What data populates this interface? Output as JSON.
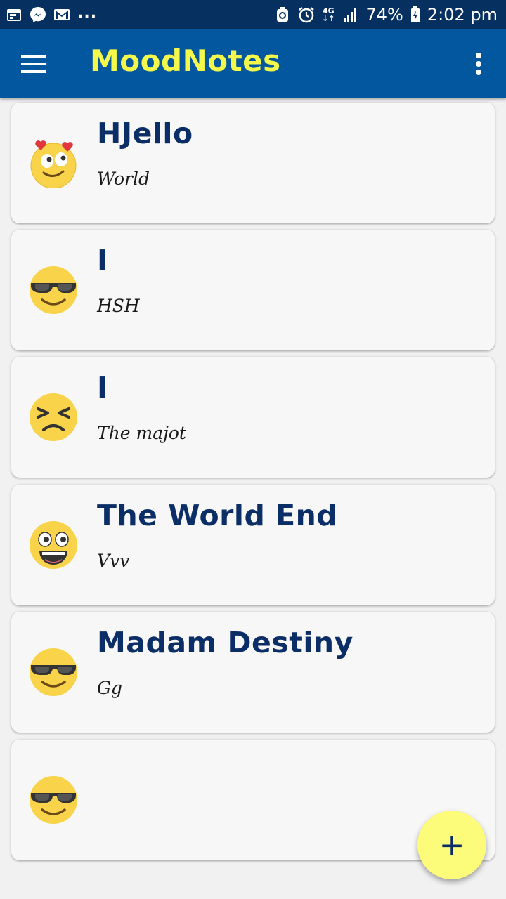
{
  "status_bar": {
    "dots": "...",
    "network_type": "4G",
    "battery_percent": "74%",
    "time": "2:02 pm",
    "icons": [
      "calendar-icon",
      "messenger-icon",
      "gmail-icon",
      "recycle-icon",
      "alarm-icon",
      "signal-icon",
      "battery-charging-icon"
    ]
  },
  "app_bar": {
    "title": "MoodNotes",
    "title_color": "#f4f84a",
    "background_color": "#02579e",
    "menu_icon": "hamburger-menu-icon",
    "overflow_icon": "more-vert-icon"
  },
  "notes": [
    {
      "title": "HJello",
      "body": "World",
      "mood": "heart-eyes-emoji-icon"
    },
    {
      "title": "I",
      "body": "HSH",
      "mood": "sunglasses-emoji-icon"
    },
    {
      "title": "I",
      "body": "The majot",
      "mood": "persevering-emoji-icon"
    },
    {
      "title": "The World End",
      "body": "Vvv",
      "mood": "grinning-emoji-icon"
    },
    {
      "title": "Madam Destiny",
      "body": "Gg",
      "mood": "sunglasses-emoji-icon"
    },
    {
      "title": "",
      "body": "",
      "mood": "sunglasses-emoji-icon"
    }
  ],
  "fab": {
    "label": "+",
    "icon": "add-icon",
    "color": "#fdfb7a"
  }
}
